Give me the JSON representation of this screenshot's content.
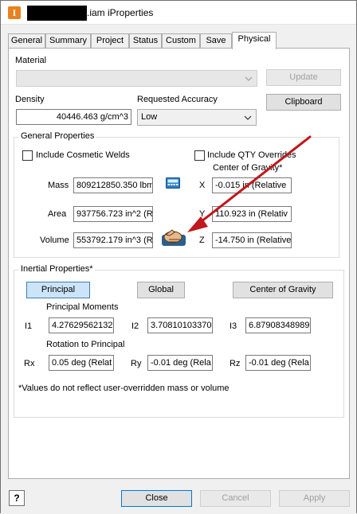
{
  "window": {
    "title": ".iam iProperties"
  },
  "tabs": [
    "General",
    "Summary",
    "Project",
    "Status",
    "Custom",
    "Save",
    "Physical"
  ],
  "material": {
    "label": "Material",
    "value": "",
    "update_label": "Update"
  },
  "density": {
    "label": "Density",
    "value": "40446.463 g/cm^3"
  },
  "accuracy": {
    "label": "Requested Accuracy",
    "value": "Low"
  },
  "clipboard_label": "Clipboard",
  "general": {
    "title": "General Properties",
    "include_cosmetic_welds": "Include Cosmetic Welds",
    "include_qty_overrides": "Include QTY Overrides",
    "cog_title": "Center of Gravity*",
    "mass_label": "Mass",
    "mass_value": "809212850.350 lbm",
    "area_label": "Area",
    "area_value": "937756.723 in^2 (R",
    "volume_label": "Volume",
    "volume_value": "553792.179 in^3 (R",
    "x_label": "X",
    "x_value": "-0.015 in (Relative",
    "y_label": "Y",
    "y_value": "110.923 in (Relativ",
    "z_label": "Z",
    "z_value": "-14.750 in (Relative"
  },
  "inertial": {
    "title": "Inertial Properties*",
    "principal_label": "Principal",
    "global_label": "Global",
    "cog_label": "Center of Gravity",
    "moments_title": "Principal Moments",
    "i1_label": "I1",
    "i1_value": "4.27629562132",
    "i2_label": "I2",
    "i2_value": "3.70810103370",
    "i3_label": "I3",
    "i3_value": "6.87908348989",
    "rotation_title": "Rotation to Principal",
    "rx_label": "Rx",
    "rx_value": "0.05 deg (Relat",
    "ry_label": "Ry",
    "ry_value": "-0.01 deg (Rela",
    "rz_label": "Rz",
    "rz_value": "-0.01 deg (Rela",
    "note": "*Values do not reflect user-overridden mass or volume"
  },
  "footer": {
    "help": "?",
    "close_label": "Close",
    "cancel_label": "Cancel",
    "apply_label": "Apply"
  },
  "colors": {
    "arrow": "#c0181c",
    "app_icon": "#e8821e",
    "selected_button": "#cce4f7"
  }
}
